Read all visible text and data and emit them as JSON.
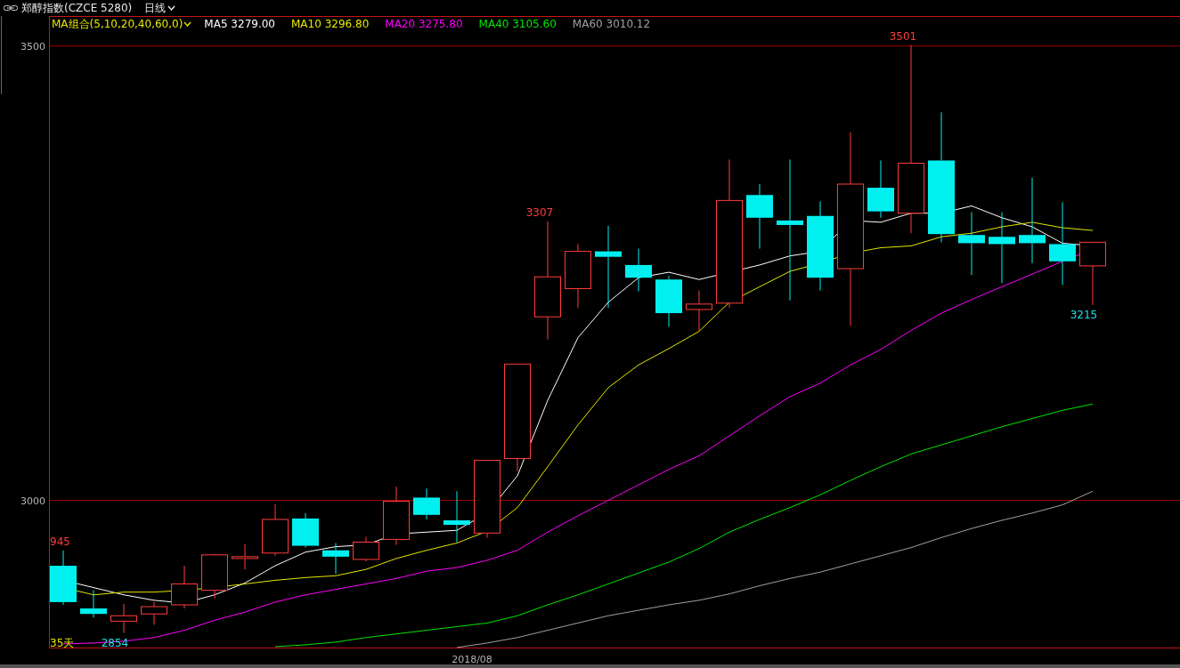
{
  "header": {
    "title": "郑醇指数(CZCE 5280)",
    "period": "日线"
  },
  "indicator": {
    "label": "MA组合(5,10,20,40,60,0)"
  },
  "legend": [
    {
      "text": "MA5 3279.00",
      "color": "#ffffff"
    },
    {
      "text": "MA10 3296.80",
      "color": "#e6e600"
    },
    {
      "text": "MA20 3275.80",
      "color": "#ff00ff"
    },
    {
      "text": "MA40 3105.60",
      "color": "#00e600"
    },
    {
      "text": "MA60 3010.12",
      "color": "#a0a0a0"
    }
  ],
  "price_axis": {
    "labels": [
      "3500",
      "3000"
    ]
  },
  "date_axis": {
    "labels": [
      "2018/08"
    ]
  },
  "price_labels": [
    {
      "text": "3501",
      "kind": "high"
    },
    {
      "text": "3307",
      "kind": "high"
    },
    {
      "text": "3215",
      "kind": "low"
    },
    {
      "text": "945",
      "kind": "high"
    },
    {
      "text": "2854",
      "kind": "low"
    },
    {
      "text": "35天",
      "kind": "count"
    }
  ]
}
